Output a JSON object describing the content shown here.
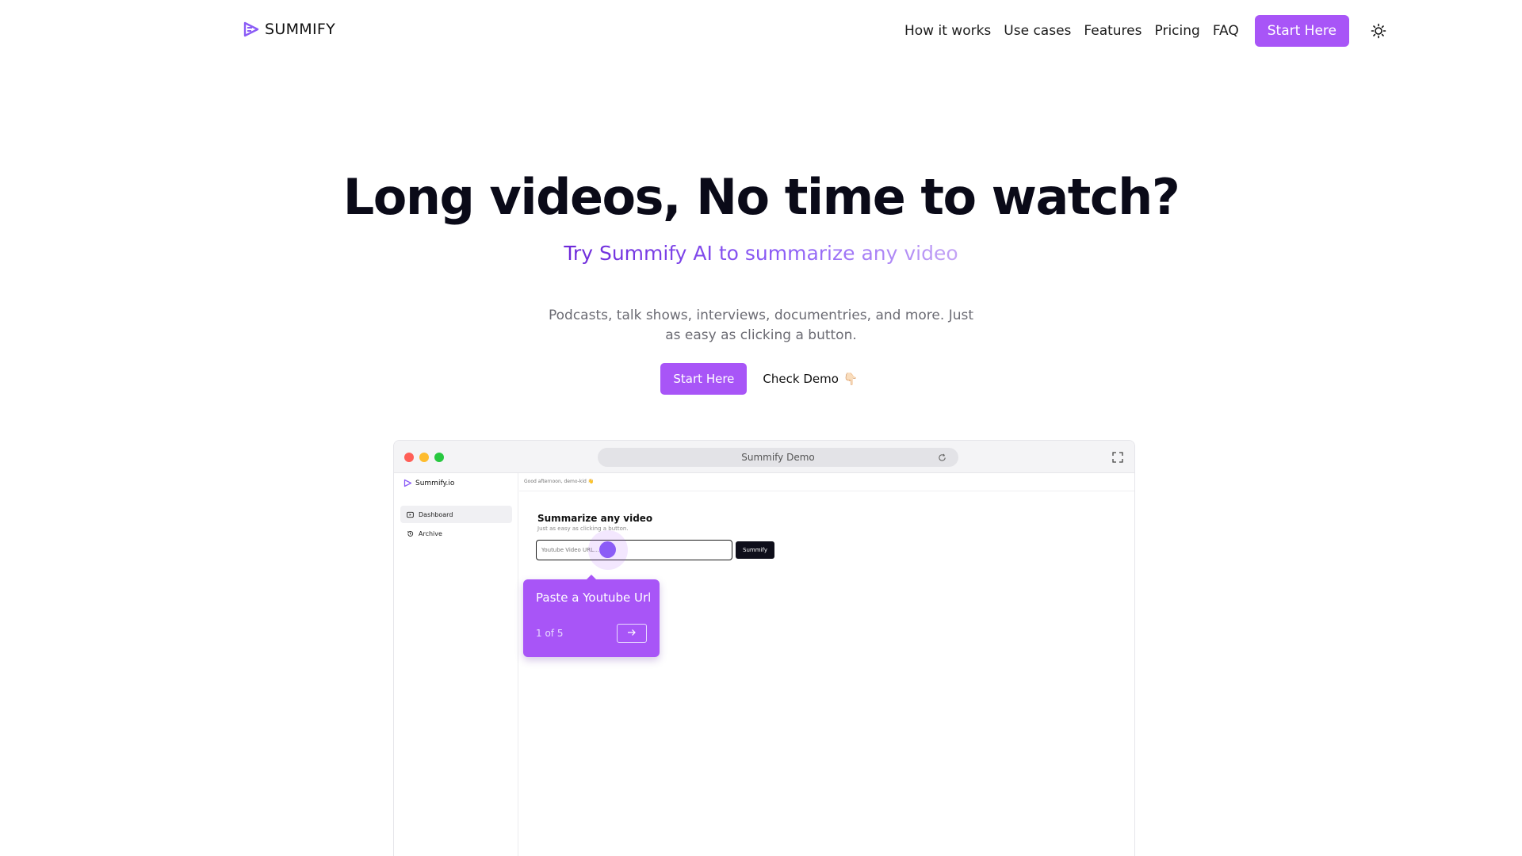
{
  "header": {
    "brand": "SUMMIFY",
    "nav": [
      "How it works",
      "Use cases",
      "Features",
      "Pricing",
      "FAQ"
    ],
    "cta": "Start Here",
    "theme_icon": "sun-icon"
  },
  "hero": {
    "title": "Long videos, No time to watch?",
    "subtitle": "Try Summify AI to summarize any video",
    "description": "Podcasts, talk shows, interviews, documentries, and more. Just as easy as clicking a button.",
    "primary_cta": "Start Here",
    "secondary_cta": "Check Demo",
    "secondary_emoji": "👇🏻"
  },
  "demo": {
    "url_title": "Summify Demo",
    "colors": {
      "close": "#ff5f57",
      "minimize": "#febc2e",
      "zoom": "#28c840",
      "accent": "#a855f7"
    },
    "sidebar": {
      "brand": "Summify.io",
      "items": [
        {
          "label": "Dashboard",
          "icon": "play-square-icon",
          "active": true
        },
        {
          "label": "Archive",
          "icon": "history-icon",
          "active": false
        }
      ]
    },
    "main": {
      "greeting": "Good afternoon, demo-kid 👋",
      "title": "Summarize any video",
      "subtitle": "Just as easy as clicking a button.",
      "input_placeholder": "Youtube Video URL...",
      "button": "Summify"
    },
    "tour": {
      "title": "Paste a Youtube Url",
      "step": "1 of 5",
      "next_icon": "arrow-right-icon"
    }
  }
}
